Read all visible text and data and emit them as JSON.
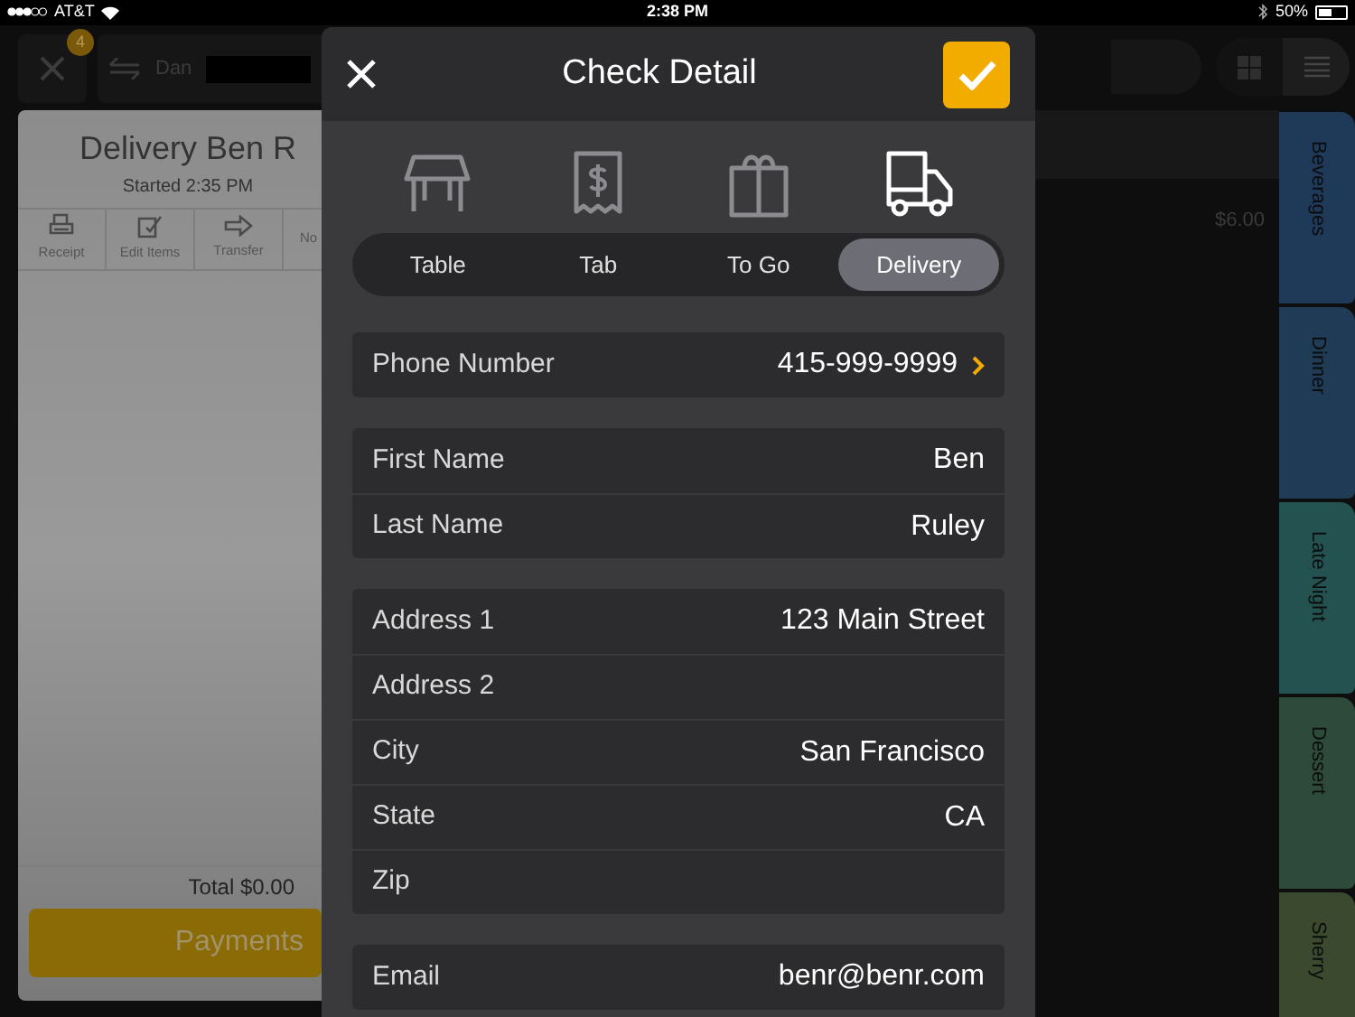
{
  "status_bar": {
    "carrier": "AT&T",
    "time": "2:38 PM",
    "battery": "50%"
  },
  "toolbar": {
    "badge": "4",
    "server": "Dan",
    "views": [
      {
        "kind": "grid",
        "selected": false
      },
      {
        "kind": "list",
        "selected": true
      }
    ]
  },
  "check": {
    "title": "Delivery Ben R",
    "started": "Started 2:35 PM",
    "actions": [
      {
        "label": "Receipt",
        "kind": "printer"
      },
      {
        "label": "Edit Items",
        "kind": "edit"
      },
      {
        "label": "Transfer",
        "kind": "arrow"
      },
      {
        "label": "No",
        "kind": "none"
      }
    ],
    "total": "Total $0.00",
    "payments": "Payments"
  },
  "menu": {
    "price": "$6.00"
  },
  "categories": [
    {
      "label": "Beverages",
      "color": "#1f3a58"
    },
    {
      "label": "Dinner",
      "color": "#1f3b55"
    },
    {
      "label": "Late Night",
      "color": "#245250"
    },
    {
      "label": "Dessert",
      "color": "#2e4a3a"
    },
    {
      "label": "Sherry",
      "color": "#3b4a2f"
    }
  ],
  "modal": {
    "title": "Check Detail",
    "order_types": [
      {
        "label": "Table",
        "kind": "table",
        "selected": false
      },
      {
        "label": "Tab",
        "kind": "receipt",
        "selected": false
      },
      {
        "label": "To Go",
        "kind": "bag",
        "selected": false
      },
      {
        "label": "Delivery",
        "kind": "truck",
        "selected": true
      }
    ],
    "groups": [
      [
        {
          "label": "Phone Number",
          "value": "415-999-9999",
          "kind": "link"
        }
      ],
      [
        {
          "label": "First Name",
          "value": "Ben",
          "kind": "text"
        },
        {
          "label": "Last Name",
          "value": "Ruley",
          "kind": "text"
        }
      ],
      [
        {
          "label": "Address 1",
          "value": "123 Main Street",
          "kind": "text"
        },
        {
          "label": "Address 2",
          "kind": "text"
        },
        {
          "label": "City",
          "value": "San Francisco",
          "kind": "text"
        },
        {
          "label": "State",
          "value": "CA",
          "kind": "text"
        },
        {
          "label": "Zip",
          "kind": "text"
        }
      ],
      [
        {
          "label": "Email",
          "value": "benr@benr.com",
          "kind": "text"
        }
      ]
    ]
  }
}
